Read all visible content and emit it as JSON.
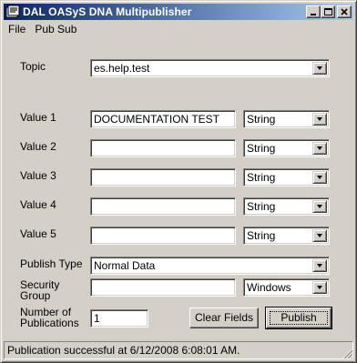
{
  "window": {
    "title": "DAL OASyS DNA Multipublisher",
    "icons": {
      "app": "app-icon",
      "minimize": "minimize-icon",
      "maximize": "maximize-icon",
      "close": "close-icon"
    }
  },
  "menu": {
    "file": "File",
    "pubsub": "Pub Sub"
  },
  "form": {
    "topic": {
      "label": "Topic",
      "value": "es.help.test"
    },
    "values": [
      {
        "label": "Value 1",
        "value": "DOCUMENTATION TEST",
        "type": "String"
      },
      {
        "label": "Value 2",
        "value": "",
        "type": "String"
      },
      {
        "label": "Value 3",
        "value": "",
        "type": "String"
      },
      {
        "label": "Value 4",
        "value": "",
        "type": "String"
      },
      {
        "label": "Value 5",
        "value": "",
        "type": "String"
      }
    ],
    "publish_type": {
      "label": "Publish Type",
      "value": "Normal Data"
    },
    "security_group": {
      "label_line1": "Security",
      "label_line2": "Group",
      "value": "",
      "auth": "Windows"
    },
    "num_publications": {
      "label_line1": "Number of",
      "label_line2": "Publications",
      "value": "1"
    }
  },
  "buttons": {
    "clear": "Clear Fields",
    "publish": "Publish"
  },
  "status": {
    "text": "Publication successful at 6/12/2008 6:08:01 AM."
  }
}
